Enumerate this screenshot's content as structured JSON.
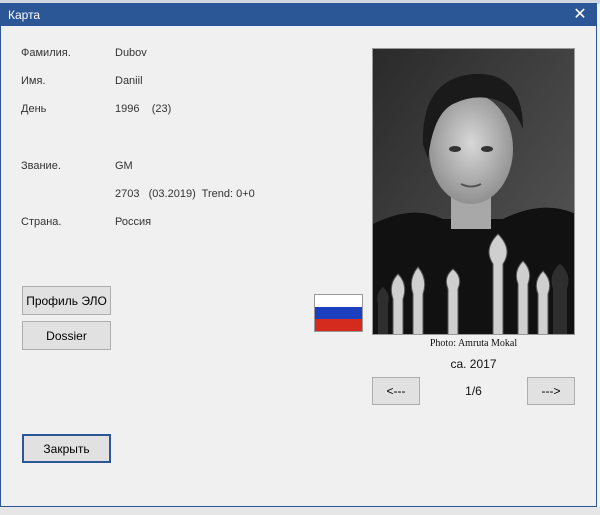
{
  "window": {
    "title": "Карта",
    "close_glyph": "✕"
  },
  "fields": {
    "surname_label": "Фамилия.",
    "surname_value": "Dubov",
    "name_label": "Имя.",
    "name_value": "Daniil",
    "day_label": "День",
    "day_value": "1996    (23)",
    "title_label": "Звание.",
    "title_value": "GM",
    "rating_value": "2703   (03.2019)  Trend: 0+0",
    "country_label": "Страна.",
    "country_value": "Россия"
  },
  "buttons": {
    "elo_profile": "Профиль ЭЛО",
    "dossier": "Dossier",
    "close": "Закрыть",
    "prev": "<---",
    "next": "--->"
  },
  "photo": {
    "credit": "Photo: Amruta Mokal",
    "year": "ca. 2017",
    "pager": "1/6"
  },
  "flag": {
    "country": "Russia",
    "colors": [
      "#ffffff",
      "#1c3fbf",
      "#d52b1e"
    ]
  },
  "theme": {
    "titlebar_color": "#2b5797",
    "window_bg": "#f0f0f0"
  }
}
